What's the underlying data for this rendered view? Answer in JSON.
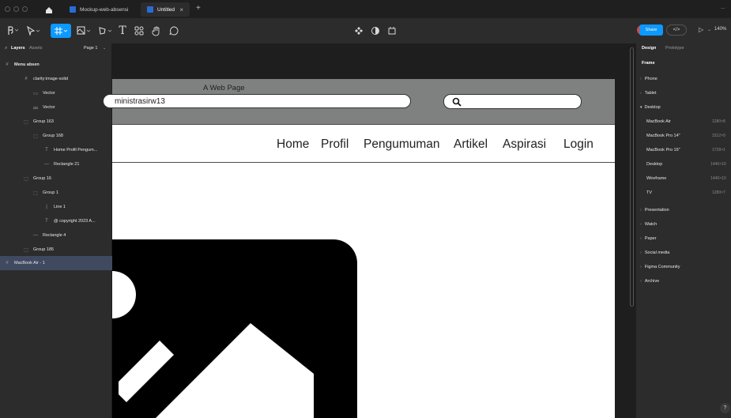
{
  "titlebar": {
    "tabs": [
      {
        "label": "Mockup-web-absensi"
      },
      {
        "label": "Untitled"
      }
    ],
    "close_glyph": "×",
    "new_tab_glyph": "+"
  },
  "toolbar": {
    "share_label": "Share",
    "zoom": "140%",
    "user_initial": "R"
  },
  "layers_panel": {
    "tab_layers": "Layers",
    "tab_assets": "Assets",
    "page": "Page 1",
    "items": [
      {
        "label": "Menu absen",
        "icon": "frame-icon"
      },
      {
        "label": "clarity:image-solid",
        "icon": "frame-icon"
      },
      {
        "label": "Vector",
        "icon": "rectangle-icon"
      },
      {
        "label": "Vector",
        "icon": "vector-icon"
      },
      {
        "label": "Group 163",
        "icon": "group-icon"
      },
      {
        "label": "Group 168",
        "icon": "group-icon"
      },
      {
        "label": "Home Profil Pengum...",
        "icon": "text-icon"
      },
      {
        "label": "Rectangle 21",
        "icon": "line-icon"
      },
      {
        "label": "Group 16",
        "icon": "group-icon"
      },
      {
        "label": "Group 1",
        "icon": "group-icon"
      },
      {
        "label": "Line 1",
        "icon": "line-icon"
      },
      {
        "label": "@ copyright 2023 A...",
        "icon": "text-icon"
      },
      {
        "label": "Rectangle 4",
        "icon": "line-icon"
      },
      {
        "label": "Group 185",
        "icon": "group-icon"
      },
      {
        "label": "MacBook Air - 1",
        "icon": "frame-icon"
      }
    ]
  },
  "canvas": {
    "frame_label": "A Web Page",
    "url_text": "ministrasirw13",
    "nav": [
      "Home",
      "Profil",
      "Pengumuman",
      "Artikel",
      "Aspirasi",
      "Login"
    ]
  },
  "design_panel": {
    "tab_design": "Design",
    "tab_prototype": "Prototype",
    "section": "Frame",
    "groups": [
      {
        "label": "Phone",
        "open": false
      },
      {
        "label": "Tablet",
        "open": false
      },
      {
        "label": "Desktop",
        "open": true
      }
    ],
    "desktop_items": [
      {
        "label": "MacBook Air",
        "size": "1280×8"
      },
      {
        "label": "MacBook Pro 14\"",
        "size": "1512×9"
      },
      {
        "label": "MacBook Pro 16\"",
        "size": "1728×1"
      },
      {
        "label": "Desktop",
        "size": "1440×10"
      },
      {
        "label": "Wireframe",
        "size": "1440×10"
      },
      {
        "label": "TV",
        "size": "1280×7"
      }
    ],
    "more_groups": [
      "Presentation",
      "Watch",
      "Paper",
      "Social media",
      "Figma Community",
      "Archive"
    ]
  },
  "colors": {
    "accent": "#0d99ff",
    "selection": "#3f4a60",
    "panel": "#2c2c2c",
    "canvas": "#1e1e1e",
    "header_gray": "#7f8080",
    "avatar": "#e8412a"
  }
}
